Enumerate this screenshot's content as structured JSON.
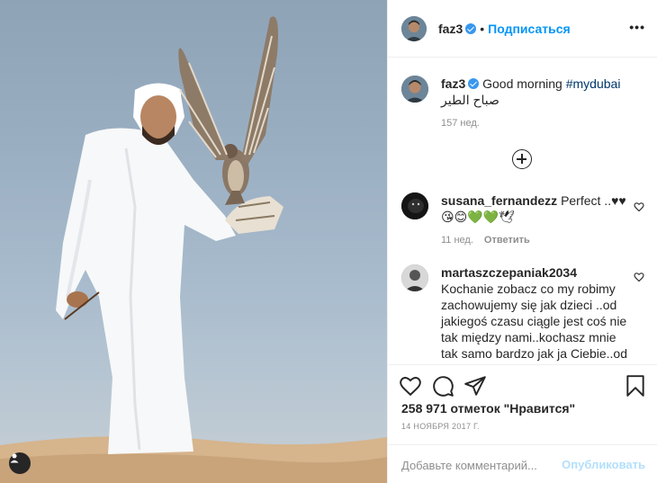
{
  "header": {
    "username": "faz3",
    "separator": "•",
    "follow_label": "Подписаться",
    "more_label": "•••"
  },
  "caption": {
    "username": "faz3",
    "text_pre": "Good morning ",
    "hashtag": "#mydubai",
    "text_post": " صباح الطير",
    "time": "157 нед."
  },
  "comments": [
    {
      "username": "susana_fernandezz",
      "text": "Perfect ..♥♥ 😘😊💚💚🕊",
      "time": "11 нед.",
      "reply_label": "Ответить"
    },
    {
      "username": "martaszczepaniak2034",
      "text": "Kochanie zobacz co my robimy zachowujemy się jak dzieci ..od jakiegoś czasu ciągle jest coś nie tak między nami..kochasz mnie tak samo bardzo jak ja Ciebie..od początku wiedziałam że nie"
    }
  ],
  "actions": {
    "likes_text": "258 971 отметок \"Нравится\"",
    "date": "14 НОЯБРЯ 2017 Г."
  },
  "add_comment": {
    "placeholder": "Добавьте комментарий...",
    "post_label": "Опубликовать"
  },
  "colors": {
    "accent": "#0095f6",
    "verified": "#3897f0",
    "muted": "#8e8e8e",
    "post_disabled": "#b2dffc"
  }
}
